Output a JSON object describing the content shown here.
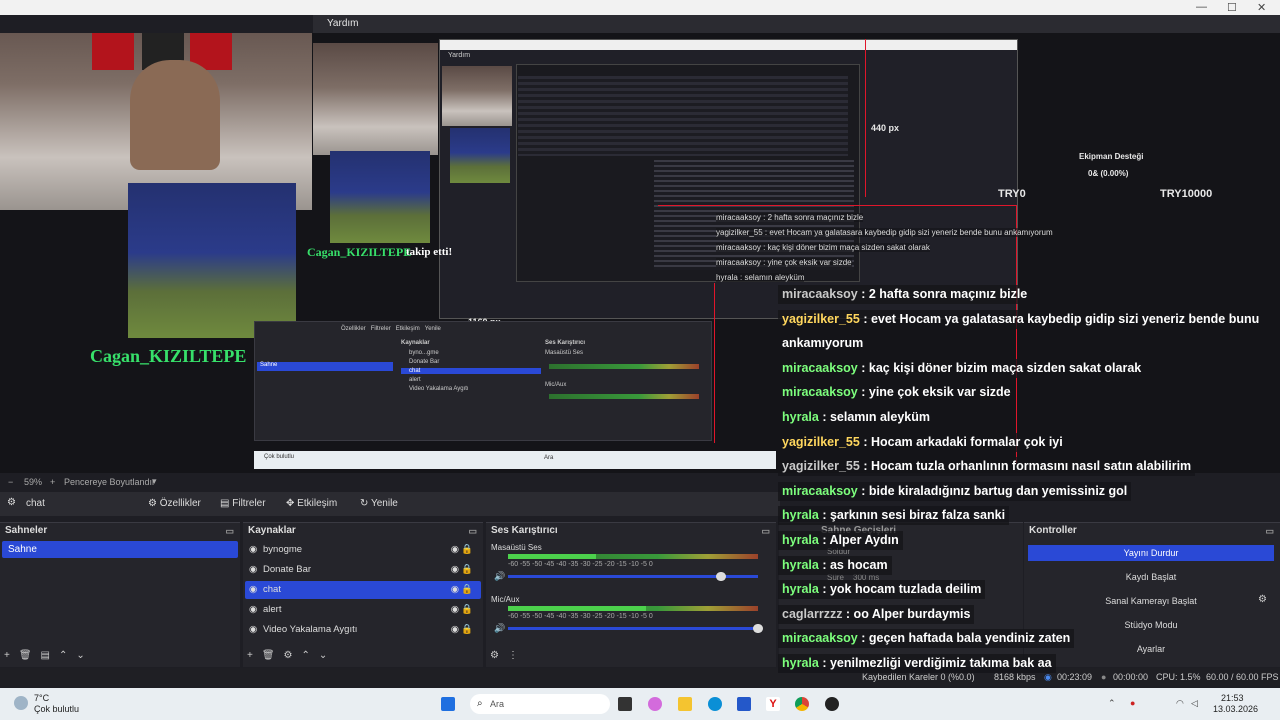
{
  "window": {
    "menu_item": "Yardım",
    "min_glyph": "—",
    "max_glyph": "☐",
    "close_glyph": "✕"
  },
  "preview": {
    "nested_menu": "Yardım",
    "follow_name": "Cagan_KIZILTEPE",
    "follow_text": "takip etti!",
    "dim_440": "440 px",
    "dim_1160": "1160 px",
    "nested_tabs": [
      "Özellikler",
      "Filtreler",
      "Etkileşim",
      "Yenile"
    ],
    "nested_scene": "Sahne",
    "nested_sources_title": "Kaynaklar",
    "nested_mixer_title": "Ses Karıştırıcı",
    "nested_sources": [
      "byno...gme",
      "Donate Bar",
      "chat",
      "alert",
      "Video Yakalama Aygıtı"
    ],
    "nested_mixer_labels": [
      "Masaüstü Ses",
      "Mic/Aux"
    ],
    "try0": "TRY0",
    "try10000": "TRY10000",
    "ekipman_title": "Ekipman Desteği",
    "ekipman_pct": "0& (0.00%)",
    "nested_search": "Ara",
    "nested_weather": "Çok bulutlu",
    "nested_msgs": [
      "miracaaksoy : 2 hafta sonra maçınız bizle",
      "yagizilker_55 : evet Hocam ya galatasara kaybedip gidip sizi yeneriz bende bunu ankamıyorum",
      "miracaaksoy : kaç kişi döner bizim maça sizden sakat olarak",
      "miracaaksoy : yine çok eksik var sizde",
      "hyrala : selamın aleyküm"
    ]
  },
  "chat": [
    {
      "user": "miracaaksoy",
      "text": " : 2 hafta sonra maçınız bizle",
      "style": "w"
    },
    {
      "user": "yagizilker_55",
      "text": " : evet Hocam ya galatasara kaybedip gidip sizi yeneriz bende bunu",
      "style": "y"
    },
    {
      "user": "",
      "text": "ankamıyorum",
      "style": "w"
    },
    {
      "user": "miracaaksoy",
      "text": " : kaç kişi döner bizim maça sizden sakat olarak",
      "style": ""
    },
    {
      "user": "miracaaksoy",
      "text": " : yine çok eksik var sizde",
      "style": ""
    },
    {
      "user": "hyrala",
      "text": " : selamın aleyküm",
      "style": ""
    },
    {
      "user": "yagizilker_55",
      "text": " : Hocam arkadaki formalar çok iyi",
      "style": "y"
    },
    {
      "user": "yagizilker_55",
      "text": " : Hocam tuzla orhanlının formasını nasıl satın alabilirim",
      "style": "w"
    },
    {
      "user": "miracaaksoy",
      "text": " : bide kiraladığınız bartug dan yemissiniz gol",
      "style": ""
    },
    {
      "user": "hyrala",
      "text": " : şarkının sesi biraz falza sanki",
      "style": ""
    },
    {
      "user": "hyrala",
      "text": " : Alper Aydın",
      "style": ""
    },
    {
      "user": "hyrala",
      "text": " : as hocam",
      "style": ""
    },
    {
      "user": "hyrala",
      "text": " : yok hocam tuzlada deilim",
      "style": ""
    },
    {
      "user": "caglarrzzz",
      "text": " : oo Alper burdaymis",
      "style": "w"
    },
    {
      "user": "miracaaksoy",
      "text": " : geçen haftada bala yendiniz zaten",
      "style": ""
    },
    {
      "user": "hyrala",
      "text": " : yenilmezliği verdiğimiz takıma bak aa",
      "style": ""
    }
  ],
  "zoom": {
    "value": "59%",
    "minus": "−",
    "plus": "+",
    "mode": "Pencereye Boyutlandır"
  },
  "source_toolbar": {
    "selected": "chat",
    "properties": "Özellikler",
    "filters": "Filtreler",
    "interact": "Etkileşim",
    "refresh": "Yenile"
  },
  "scenes": {
    "title": "Sahneler",
    "items": [
      {
        "label": "Sahne",
        "selected": true
      }
    ]
  },
  "sources": {
    "title": "Kaynaklar",
    "items": [
      {
        "label": "bynogme",
        "selected": false
      },
      {
        "label": "Donate Bar",
        "selected": false
      },
      {
        "label": "chat",
        "selected": true
      },
      {
        "label": "alert",
        "selected": false
      },
      {
        "label": "Video Yakalama Aygıtı",
        "selected": false
      }
    ]
  },
  "mixer": {
    "title": "Ses Karıştırıcı",
    "channels": [
      {
        "label": "Masaüstü Ses",
        "level": 0.35,
        "volume": 0.85
      },
      {
        "label": "Mic/Aux",
        "level": 0.55,
        "volume": 1.0
      }
    ],
    "ticks": "-60   -55   -50   -45   -40   -35   -30   -25   -20   -15   -10   -5    0"
  },
  "transitions": {
    "title": "Sahne Geçişleri",
    "type": "Soldur",
    "duration_label": "Süre",
    "duration": "300 ms"
  },
  "controls": {
    "title": "Kontroller",
    "buttons": [
      "Yayını Durdur",
      "Kaydı Başlat",
      "Sanal Kamerayı Başlat",
      "Stüdyo Modu",
      "Ayarlar"
    ]
  },
  "status": {
    "dropped": "Kaybedilen Kareler 0 (%0.0)",
    "bitrate": "8168 kbps",
    "stream_time": "00:23:09",
    "rec_time": "00:00:00",
    "cpu": "CPU: 1.5%",
    "fps": "60.00 / 60.00 FPS"
  },
  "taskbar": {
    "temp": "7°C",
    "weather": "Çok bulutlu",
    "search": "Ara",
    "time": "21:53",
    "date": "13.03.2026"
  },
  "colors": {
    "accent": "#2a49d6",
    "chat_user": "#7dff7d",
    "follow_name": "#37e06a",
    "red_bound": "#e0162b"
  }
}
